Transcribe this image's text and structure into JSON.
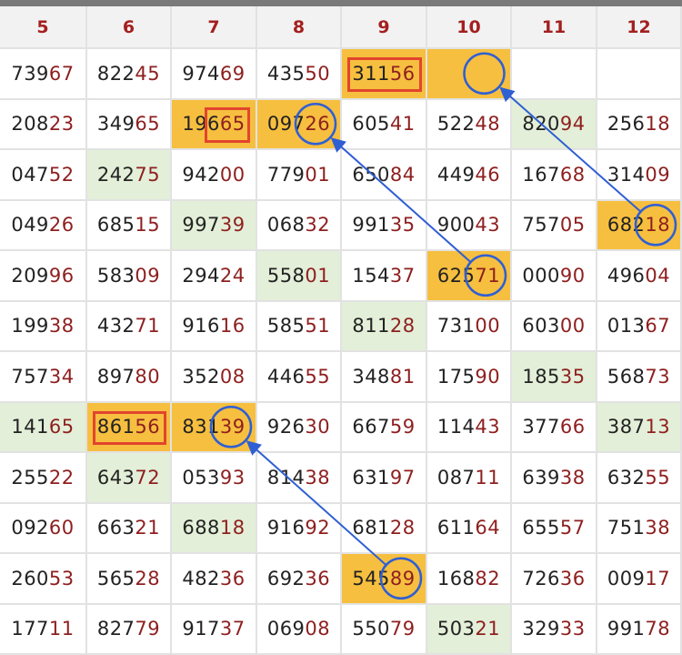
{
  "columns": [
    "5",
    "6",
    "7",
    "8",
    "9",
    "10",
    "11",
    "12"
  ],
  "rows": [
    [
      "73967",
      "82245",
      "97469",
      "43550",
      "31156",
      "",
      "",
      ""
    ],
    [
      "20823",
      "34965",
      "19665",
      "09726",
      "60541",
      "52248",
      "82094",
      "25618"
    ],
    [
      "04752",
      "24275",
      "94200",
      "77901",
      "65084",
      "44946",
      "16768",
      "31409"
    ],
    [
      "04926",
      "68515",
      "99739",
      "06832",
      "99135",
      "90043",
      "75705",
      "68218"
    ],
    [
      "20996",
      "58309",
      "29424",
      "55801",
      "15437",
      "62571",
      "00090",
      "49604"
    ],
    [
      "19938",
      "43271",
      "91616",
      "58551",
      "81128",
      "73100",
      "60300",
      "01367"
    ],
    [
      "75734",
      "89780",
      "35208",
      "44655",
      "34881",
      "17590",
      "18535",
      "56873"
    ],
    [
      "14165",
      "86156",
      "83139",
      "92630",
      "66759",
      "11443",
      "37766",
      "38713"
    ],
    [
      "25522",
      "64372",
      "05393",
      "81438",
      "63197",
      "08711",
      "63938",
      "63255"
    ],
    [
      "09260",
      "66321",
      "68818",
      "91692",
      "68128",
      "61164",
      "65557",
      "75138"
    ],
    [
      "26053",
      "56528",
      "48236",
      "69236",
      "54589",
      "16882",
      "72636",
      "00917"
    ],
    [
      "17711",
      "82779",
      "91737",
      "06908",
      "55079",
      "50321",
      "32933",
      "99178"
    ]
  ],
  "highlighted_yellow": [
    "0-4",
    "0-5",
    "1-2",
    "1-3",
    "3-7",
    "4-5",
    "7-1",
    "7-2",
    "10-4"
  ],
  "highlighted_green": [
    "1-6",
    "2-1",
    "3-2",
    "4-3",
    "5-4",
    "6-6",
    "7-0",
    "7-7",
    "8-1",
    "9-2",
    "11-5"
  ],
  "boxed_cells": [
    "0-4",
    "7-1"
  ],
  "boxed_last_two": [
    "1-2"
  ],
  "circled": [
    "0-5",
    "1-3",
    "3-7",
    "4-5",
    "7-2",
    "10-4"
  ],
  "arrows": [
    {
      "from": "3-7",
      "to": "0-5"
    },
    {
      "from": "4-5",
      "to": "1-3"
    },
    {
      "from": "10-4",
      "to": "7-2"
    }
  ],
  "colors": {
    "header_text": "#a41f1f",
    "prefix_digits": "#222222",
    "suffix_digits": "#8e1f1f",
    "yellow_fill": "#f6bf3f",
    "green_fill": "#e3efd8",
    "box_red": "#e2452d",
    "circle_blue": "#2f5fd3"
  }
}
